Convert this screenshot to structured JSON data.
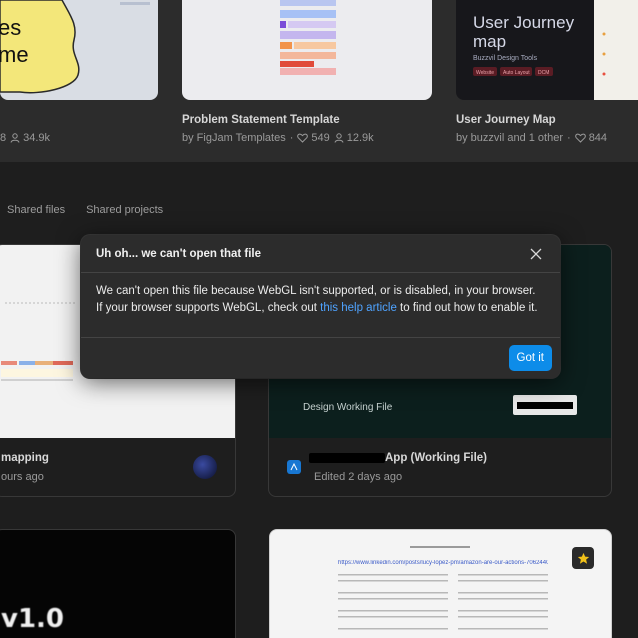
{
  "templates": [
    {
      "title": "",
      "likes": "8",
      "uses": "34.9k",
      "thumb_text": [
        "es",
        "me"
      ]
    },
    {
      "title": "Problem Statement Template",
      "author": "by FigJam Templates",
      "likes": "549",
      "uses": "12.9k"
    },
    {
      "title": "User Journey Map",
      "author": "by buzzvil and 1 other",
      "likes": "844",
      "thumb_title": [
        "User Journey",
        "map"
      ],
      "thumb_subtitle": "Buzzvil Design Tools",
      "thumb_tags": [
        "Website",
        "Auto Layout",
        "DCM"
      ]
    }
  ],
  "tabs": [
    "Shared files",
    "Shared projects"
  ],
  "files": [
    {
      "name": "mapping",
      "edited": "ours ago"
    },
    {
      "name": "App (Working File)",
      "edited": "Edited 2 days ago",
      "thumb_label": "Design Working File"
    },
    {
      "name": "",
      "thumb_text": "v1.0"
    },
    {
      "name": "",
      "thumb_link": "https://www.linkedin.com/posts/lucy-lopez-pm/amazon-are-our-actions-7062440900712054-lV-Y"
    }
  ],
  "modal": {
    "title": "Uh oh... we can't open that file",
    "body_before": "We can't open this file because WebGL isn't supported, or is disabled, in your browser. If your browser supports WebGL, check out ",
    "link_text": "this help article",
    "body_after": " to find out how to enable it.",
    "confirm_label": "Got it"
  },
  "colors": {
    "accent": "#0d8ce9",
    "link": "#4fa3ff",
    "background": "#1e1e1e",
    "modal": "#2c2c2c"
  }
}
